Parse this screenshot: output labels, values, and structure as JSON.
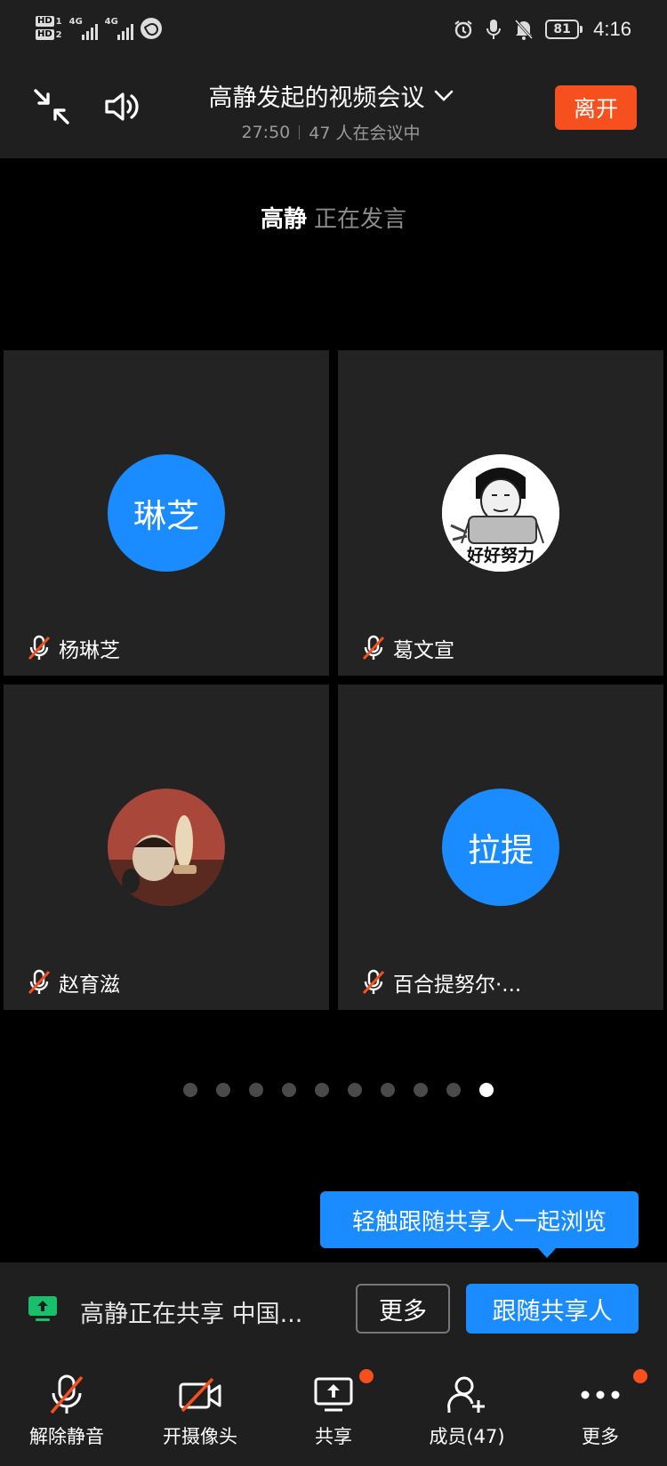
{
  "status_bar": {
    "hd1": "HD",
    "hd1_num": "1",
    "hd2": "HD",
    "hd2_num": "2",
    "net1": "4G",
    "net2": "4G",
    "battery": "81",
    "time": "4:16"
  },
  "header": {
    "title": "高静发起的视频会议",
    "duration": "27:50",
    "participants": "47 人在会议中",
    "leave_label": "离开"
  },
  "speaker": {
    "name": "高静",
    "status": "正在发言"
  },
  "tiles": [
    {
      "avatar_text": "琳芝",
      "name": "杨琳芝",
      "muted": true
    },
    {
      "avatar_text": "",
      "avatar_image_caption": "好好努力",
      "name": "葛文宣",
      "muted": true
    },
    {
      "avatar_text": "",
      "name": "赵育滋",
      "muted": true
    },
    {
      "avatar_text": "拉提",
      "name": "百合提努尔·...",
      "muted": true
    }
  ],
  "pagination": {
    "total": 10,
    "active_index": 9
  },
  "tooltip": "轻触跟随共享人一起浏览",
  "share_bar": {
    "text": "高静正在共享 中国...",
    "more_label": "更多",
    "follow_label": "跟随共享人"
  },
  "toolbar": {
    "unmute": "解除静音",
    "camera": "开摄像头",
    "share": "共享",
    "members": "成员(47)",
    "more": "更多"
  },
  "colors": {
    "accent_blue": "#1a8cff",
    "leave_orange": "#f5501e",
    "badge_orange": "#f5501e",
    "mute_slash_red": "#f5501e",
    "share_green": "#19c06b"
  }
}
